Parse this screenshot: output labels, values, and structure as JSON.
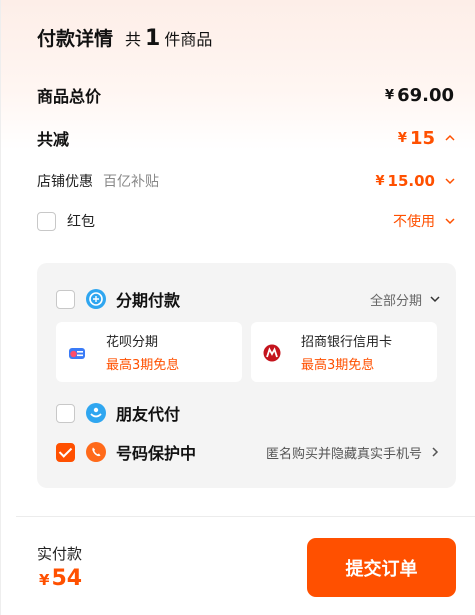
{
  "header": {
    "title": "付款详情",
    "count_prefix": "共",
    "count_number": "1",
    "count_suffix": "件商品"
  },
  "summary": {
    "total_label": "商品总价",
    "currency": "¥",
    "total_value": "69.00",
    "discount_label": "共减",
    "discount_value": "15",
    "shop_discount_label": "店铺优惠",
    "shop_discount_sub": "百亿补贴",
    "shop_discount_value": "15.00",
    "redpacket_label": "红包",
    "redpacket_status": "不使用"
  },
  "payment": {
    "installment_label": "分期付款",
    "installment_option": "全部分期",
    "cards": [
      {
        "name": "花呗分期",
        "promo": "最高3期免息"
      },
      {
        "name": "招商银行信用卡",
        "promo": "最高3期免息"
      }
    ],
    "friend_pay_label": "朋友代付",
    "number_protect_label": "号码保护中",
    "number_protect_desc": "匿名购买并隐藏真实手机号"
  },
  "footer": {
    "pay_label": "实付款",
    "currency": "¥",
    "pay_value": "54",
    "submit_label": "提交订单"
  },
  "colors": {
    "accent": "#ff5000",
    "installment_icon": "#2fa6f0",
    "friend_icon": "#2fa6f0",
    "protect_icon": "#ff6a1a"
  },
  "icons": {
    "installment": "installment-icon",
    "huabei": "huabei-icon",
    "cmb": "cmb-bank-icon",
    "friend_pay": "friend-pay-icon",
    "number_protect": "phone-protect-icon"
  }
}
